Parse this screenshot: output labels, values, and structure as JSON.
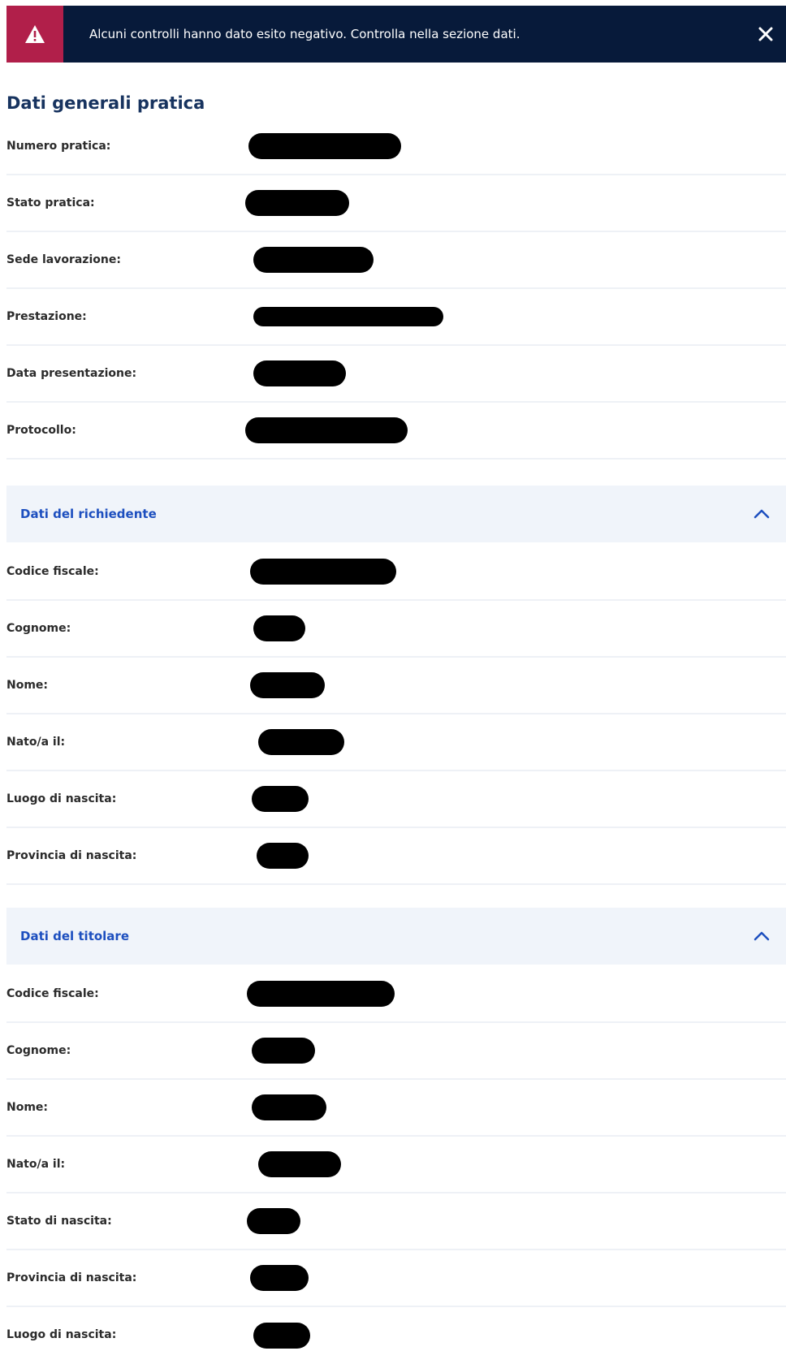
{
  "alert": {
    "message": "Alcuni controlli hanno dato esito negativo. Controlla nella sezione dati.",
    "icon": "warning-icon",
    "close_icon": "close-icon",
    "accent_color": "#b11f4a",
    "background_color": "#071a3a"
  },
  "general": {
    "title": "Dati generali pratica",
    "rows": [
      {
        "label": "Numero pratica:"
      },
      {
        "label": "Stato pratica:"
      },
      {
        "label": "Sede lavorazione:"
      },
      {
        "label": "Prestazione:"
      },
      {
        "label": "Data presentazione:"
      },
      {
        "label": "Protocollo:"
      }
    ]
  },
  "richiedente": {
    "title": "Dati del richiedente",
    "expanded": true,
    "chevron_icon": "chevron-up-icon",
    "rows": [
      {
        "label": "Codice fiscale:"
      },
      {
        "label": "Cognome:"
      },
      {
        "label": "Nome:"
      },
      {
        "label": "Nato/a il:"
      },
      {
        "label": "Luogo di nascita:"
      },
      {
        "label": "Provincia di nascita:"
      }
    ]
  },
  "titolare": {
    "title": "Dati del titolare",
    "expanded": true,
    "chevron_icon": "chevron-up-icon",
    "rows": [
      {
        "label": "Codice fiscale:"
      },
      {
        "label": "Cognome:"
      },
      {
        "label": "Nome:"
      },
      {
        "label": "Nato/a il:"
      },
      {
        "label": "Stato di nascita:"
      },
      {
        "label": "Provincia di nascita:"
      },
      {
        "label": "Luogo di nascita:"
      }
    ]
  },
  "colors": {
    "title_blue": "#17335f",
    "accordion_text": "#1d4fbf",
    "accordion_bg": "#f0f4fa",
    "redaction": "#000000"
  }
}
